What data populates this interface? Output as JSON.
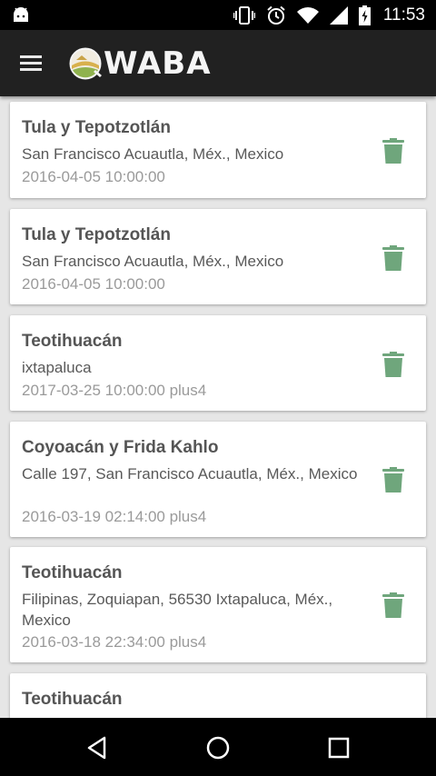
{
  "status_bar": {
    "time": "11:53",
    "icons": [
      "android-icon",
      "vibrate-icon",
      "alarm-icon",
      "wifi-icon",
      "signal-icon",
      "battery-icon"
    ]
  },
  "app_bar": {
    "logo_text": "WABA",
    "menu_icon": "hamburger-menu-icon"
  },
  "colors": {
    "app_bar": "#212121",
    "delete_icon": "#6fa67c",
    "title": "#555555",
    "date": "#9a9a9a"
  },
  "items": [
    {
      "title": "Tula y Tepotzotlán",
      "address": "San Francisco Acuautla, Méx., Mexico",
      "date": "2016-04-05 10:00:00"
    },
    {
      "title": "Tula y Tepotzotlán",
      "address": "San Francisco Acuautla, Méx., Mexico",
      "date": "2016-04-05 10:00:00"
    },
    {
      "title": "Teotihuacán",
      "address": "ixtapaluca",
      "date": "2017-03-25 10:00:00 plus4"
    },
    {
      "title": "Coyoacán y Frida Kahlo",
      "address": "Calle 197, San Francisco Acuautla, Méx., Mexico",
      "date": "2016-03-19 02:14:00 plus4"
    },
    {
      "title": "Teotihuacán",
      "address": "Filipinas, Zoquiapan, 56530 Ixtapaluca, Méx., Mexico",
      "date": "2016-03-18 22:34:00 plus4"
    },
    {
      "title": "Teotihuacán",
      "address": "",
      "date": ""
    }
  ],
  "nav_bar": {
    "buttons": [
      "back-icon",
      "home-icon",
      "recents-icon"
    ]
  }
}
